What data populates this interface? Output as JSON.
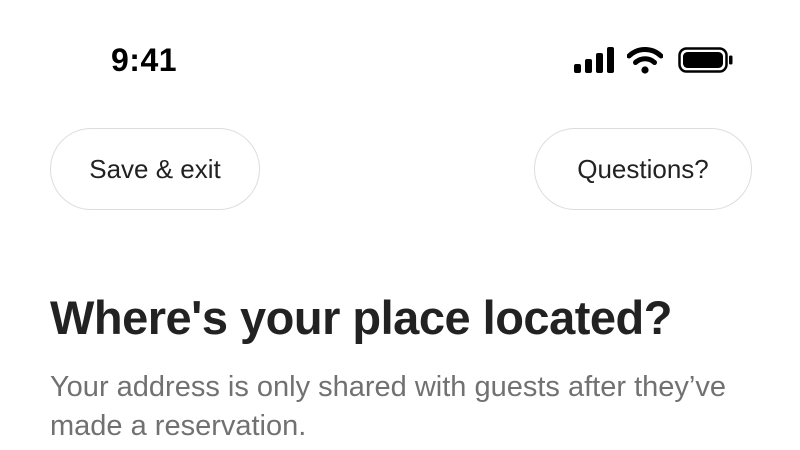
{
  "status_bar": {
    "time": "9:41",
    "icons": [
      "signal-icon",
      "wifi-icon",
      "battery-icon"
    ]
  },
  "header": {
    "save_exit_label": "Save & exit",
    "questions_label": "Questions?"
  },
  "main": {
    "title": "Where's your place located?",
    "subtitle": "Your address is only shared with guests after they’ve made a reservation."
  },
  "colors": {
    "text_primary": "#222222",
    "text_secondary": "#717171",
    "button_border": "#dddddd",
    "background": "#ffffff"
  }
}
